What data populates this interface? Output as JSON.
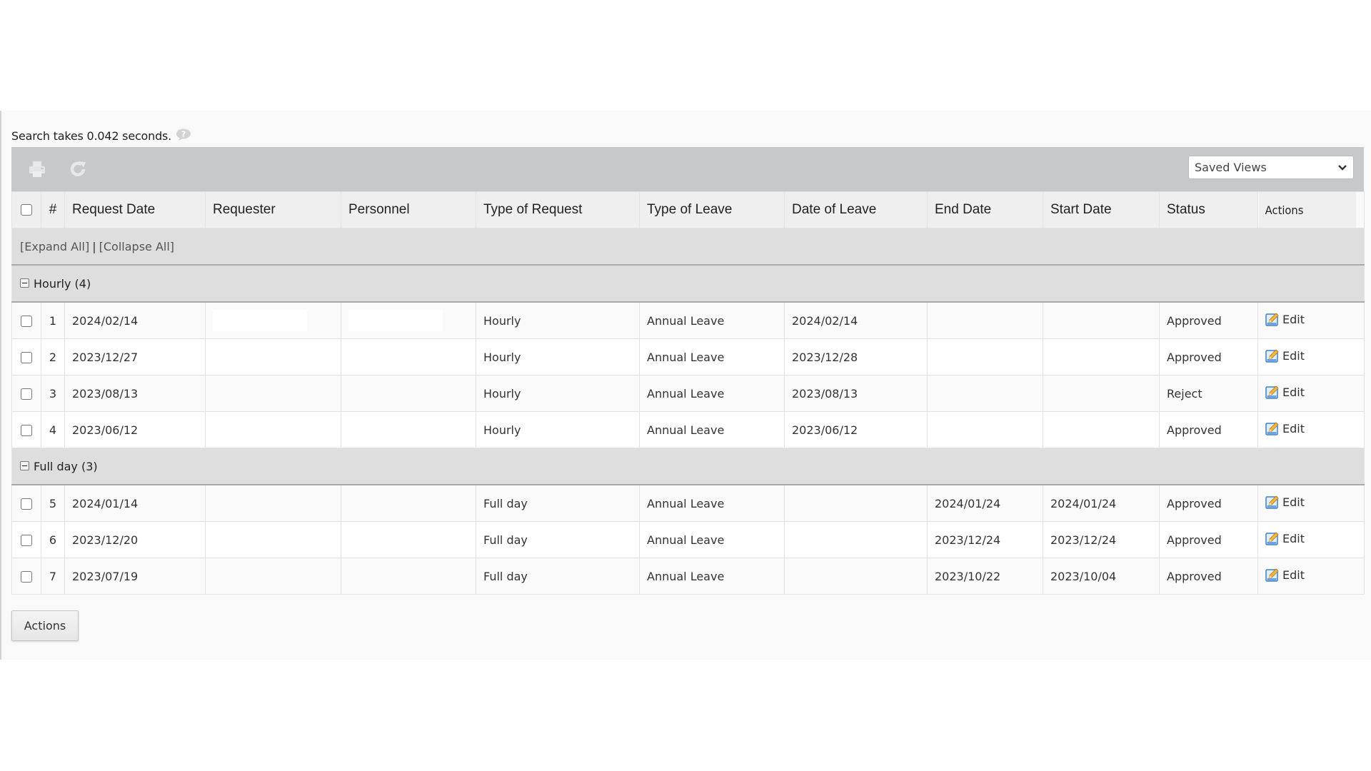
{
  "search_info": {
    "text": "Search takes 0.042 seconds.",
    "help_icon": "help-bubble-icon"
  },
  "toolbar": {
    "print_icon": "printer-icon",
    "refresh_icon": "refresh-icon",
    "saved_views": {
      "selected": "Saved Views"
    }
  },
  "table": {
    "columns": [
      "#",
      "Request Date",
      "Requester",
      "Personnel",
      "Type of Request",
      "Type of Leave",
      "Date of Leave",
      "End Date",
      "Start Date",
      "Status",
      "Actions"
    ],
    "expand_all": "[Expand All]",
    "separator": "|",
    "collapse_all": "[Collapse All]",
    "groups": [
      {
        "label": "Hourly (4)",
        "rows": [
          {
            "num": "1",
            "request_date": "2024/02/14",
            "requester": "",
            "personnel": "",
            "type_of_request": "Hourly",
            "type_of_leave": "Annual Leave",
            "date_of_leave": "2024/02/14",
            "end_date": "",
            "start_date": "",
            "status": "Approved",
            "action": "Edit"
          },
          {
            "num": "2",
            "request_date": "2023/12/27",
            "requester": "",
            "personnel": "",
            "type_of_request": "Hourly",
            "type_of_leave": "Annual Leave",
            "date_of_leave": "2023/12/28",
            "end_date": "",
            "start_date": "",
            "status": "Approved",
            "action": "Edit"
          },
          {
            "num": "3",
            "request_date": "2023/08/13",
            "requester": "",
            "personnel": "",
            "type_of_request": "Hourly",
            "type_of_leave": "Annual Leave",
            "date_of_leave": "2023/08/13",
            "end_date": "",
            "start_date": "",
            "status": "Reject",
            "action": "Edit"
          },
          {
            "num": "4",
            "request_date": "2023/06/12",
            "requester": "",
            "personnel": "",
            "type_of_request": "Hourly",
            "type_of_leave": "Annual Leave",
            "date_of_leave": "2023/06/12",
            "end_date": "",
            "start_date": "",
            "status": "Approved",
            "action": "Edit"
          }
        ]
      },
      {
        "label": "Full day (3)",
        "rows": [
          {
            "num": "5",
            "request_date": "2024/01/14",
            "requester": "",
            "personnel": "",
            "type_of_request": "Full day",
            "type_of_leave": "Annual Leave",
            "date_of_leave": "",
            "end_date": "2024/01/24",
            "start_date": "2024/01/24",
            "status": "Approved",
            "action": "Edit"
          },
          {
            "num": "6",
            "request_date": "2023/12/20",
            "requester": "",
            "personnel": "",
            "type_of_request": "Full day",
            "type_of_leave": "Annual Leave",
            "date_of_leave": "",
            "end_date": "2023/12/24",
            "start_date": "2023/12/24",
            "status": "Approved",
            "action": "Edit"
          },
          {
            "num": "7",
            "request_date": "2023/07/19",
            "requester": "",
            "personnel": "",
            "type_of_request": "Full day",
            "type_of_leave": "Annual Leave",
            "date_of_leave": "",
            "end_date": "2023/10/22",
            "start_date": "2023/10/04",
            "status": "Approved",
            "action": "Edit"
          }
        ]
      }
    ]
  },
  "footer": {
    "actions_label": "Actions"
  }
}
